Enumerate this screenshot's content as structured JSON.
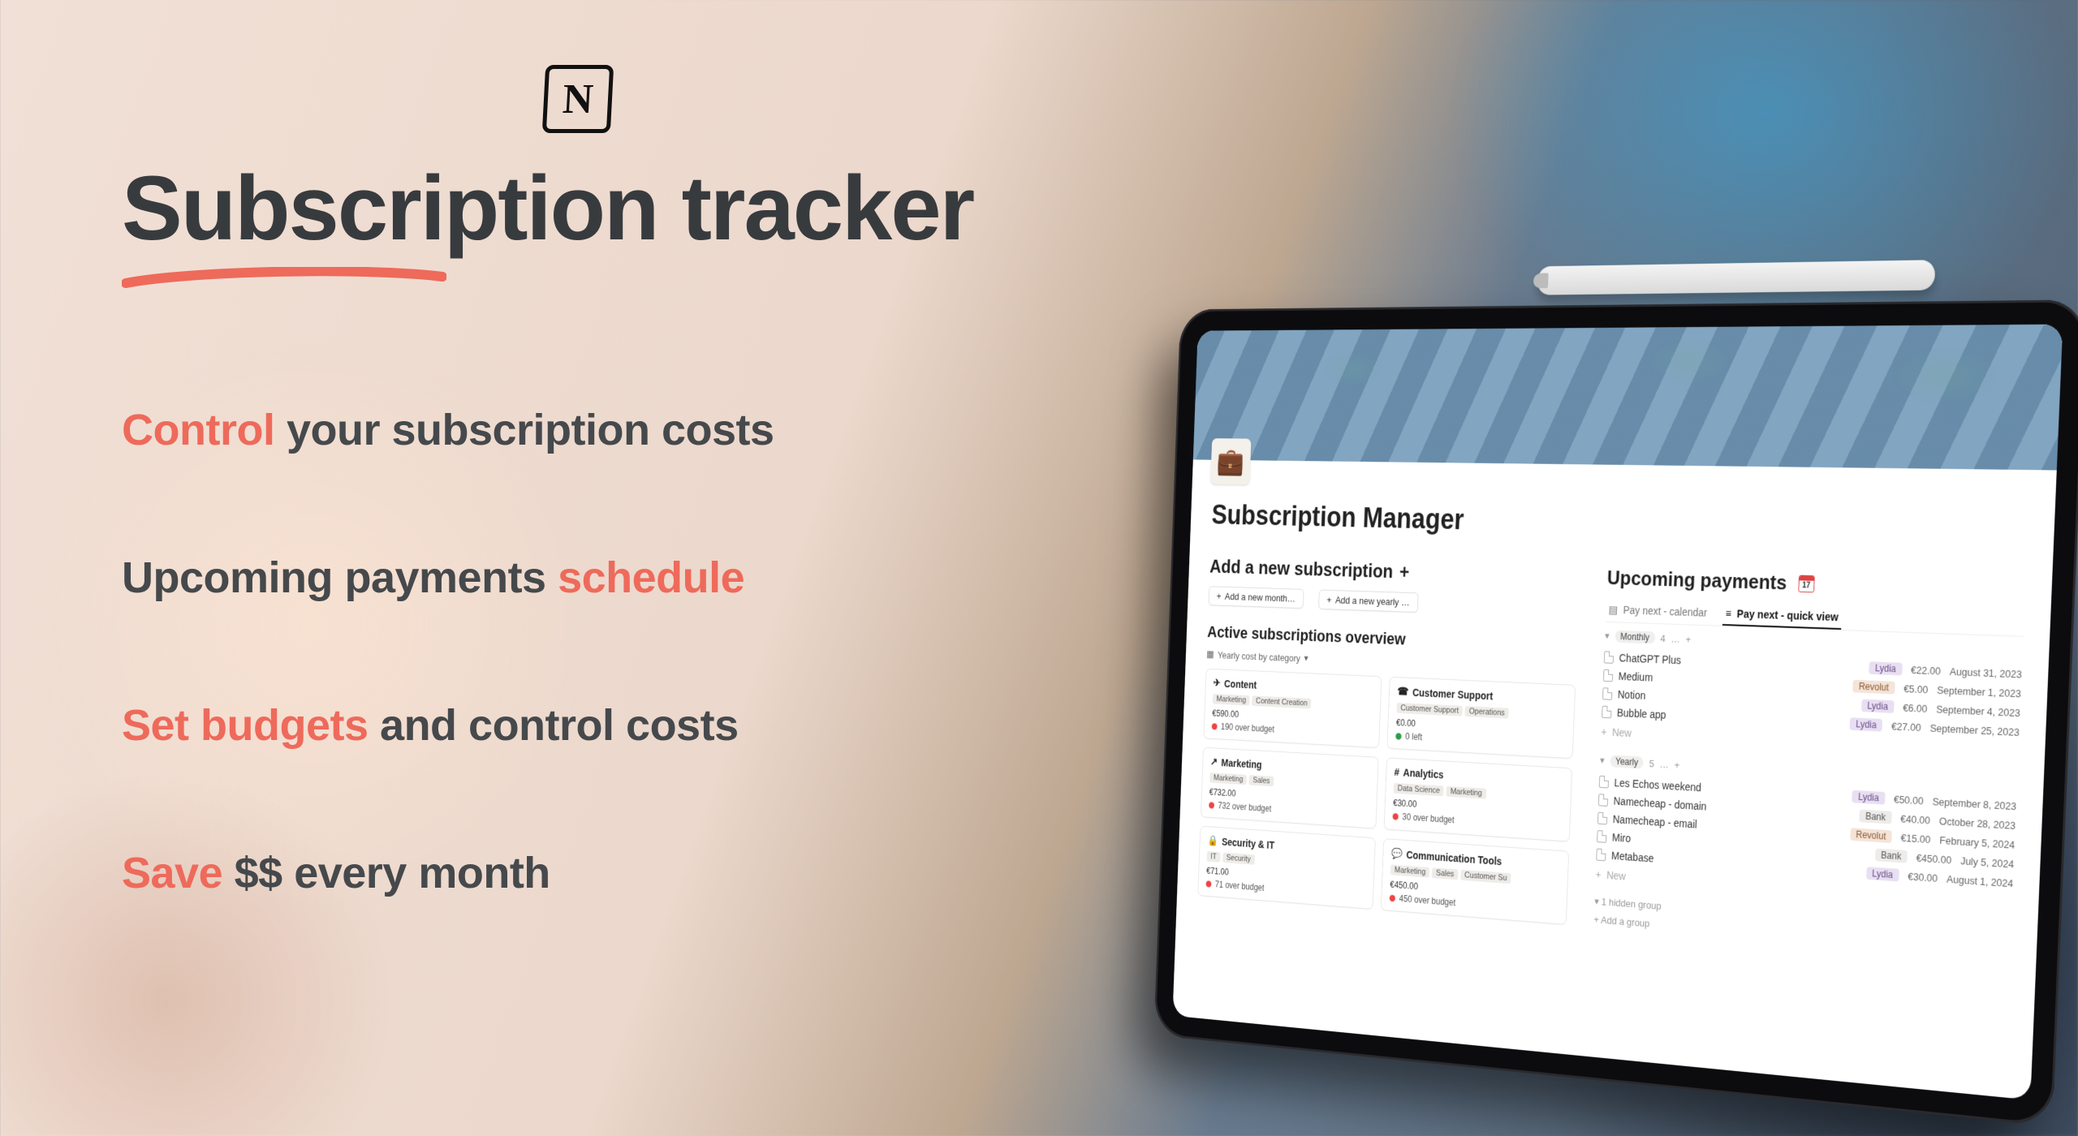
{
  "marketing": {
    "logo_letter": "N",
    "headline": "Subscription tracker",
    "bullets": [
      {
        "pre": "",
        "hl": "Control",
        "post": " your subscription costs"
      },
      {
        "pre": "Upcoming payments ",
        "hl": "schedule",
        "post": ""
      },
      {
        "pre": "",
        "hl": "Set budgets",
        "post": " and control costs"
      },
      {
        "pre": "",
        "hl": "Save",
        "post": " $$ every month"
      }
    ]
  },
  "app": {
    "page_title": "Subscription Manager",
    "page_icon": "💼",
    "add_section_title": "Add a new subscription",
    "add_section_plus": "+",
    "add_month_btn": "Add a new month…",
    "add_yearly_btn": "Add a new yearly …",
    "overview_title": "Active subscriptions overview",
    "overview_view_label": "Yearly cost by category",
    "cards": [
      {
        "icon": "✈",
        "title": "Content",
        "tags": [
          "Marketing",
          "Content Creation"
        ],
        "amount": "€590.00",
        "dot": "red",
        "budget": "190 over budget"
      },
      {
        "icon": "☎",
        "title": "Customer Support",
        "tags": [
          "Customer Support",
          "Operations"
        ],
        "amount": "€0.00",
        "dot": "green",
        "budget": "0 left"
      },
      {
        "icon": "↗",
        "title": "Marketing",
        "tags": [
          "Marketing",
          "Sales"
        ],
        "amount": "€732.00",
        "dot": "red",
        "budget": "732 over budget"
      },
      {
        "icon": "#",
        "title": "Analytics",
        "tags": [
          "Data Science",
          "Marketing"
        ],
        "amount": "€30.00",
        "dot": "red",
        "budget": "30 over budget"
      },
      {
        "icon": "🔒",
        "title": "Security & IT",
        "tags": [
          "IT",
          "Security"
        ],
        "amount": "€71.00",
        "dot": "red",
        "budget": "71 over budget"
      },
      {
        "icon": "💬",
        "title": "Communication Tools",
        "tags": [
          "Marketing",
          "Sales",
          "Customer Su"
        ],
        "amount": "€450.00",
        "dot": "red",
        "budget": "450 over budget"
      }
    ],
    "upcoming_title": "Upcoming payments",
    "calendar_day": "17",
    "tabs": {
      "calendar": "Pay next - calendar",
      "quick": "Pay next - quick view"
    },
    "groups": {
      "monthly": {
        "label": "Monthly",
        "count": "4",
        "dots": "…",
        "items": [
          {
            "name": "ChatGPT Plus",
            "src": "Lydia",
            "price": "€22.00",
            "date": "August 31, 2023"
          },
          {
            "name": "Medium",
            "src": "Revolut",
            "price": "€5.00",
            "date": "September 1, 2023"
          },
          {
            "name": "Notion",
            "src": "Lydia",
            "price": "€6.00",
            "date": "September 4, 2023"
          },
          {
            "name": "Bubble app",
            "src": "Lydia",
            "price": "€27.00",
            "date": "September 25, 2023"
          }
        ],
        "new": "New"
      },
      "yearly": {
        "label": "Yearly",
        "count": "5",
        "dots": "…",
        "items": [
          {
            "name": "Les Echos weekend",
            "src": "Lydia",
            "price": "€50.00",
            "date": "September 8, 2023"
          },
          {
            "name": "Namecheap - domain",
            "src": "Bank",
            "price": "€40.00",
            "date": "October 28, 2023"
          },
          {
            "name": "Namecheap - email",
            "src": "Revolut",
            "price": "€15.00",
            "date": "February 5, 2024"
          },
          {
            "name": "Miro",
            "src": "Bank",
            "price": "€450.00",
            "date": "July 5, 2024"
          },
          {
            "name": "Metabase",
            "src": "Lydia",
            "price": "€30.00",
            "date": "August 1, 2024"
          }
        ],
        "new": "New"
      }
    },
    "hidden_group": "1 hidden group",
    "add_group": "Add a group"
  }
}
